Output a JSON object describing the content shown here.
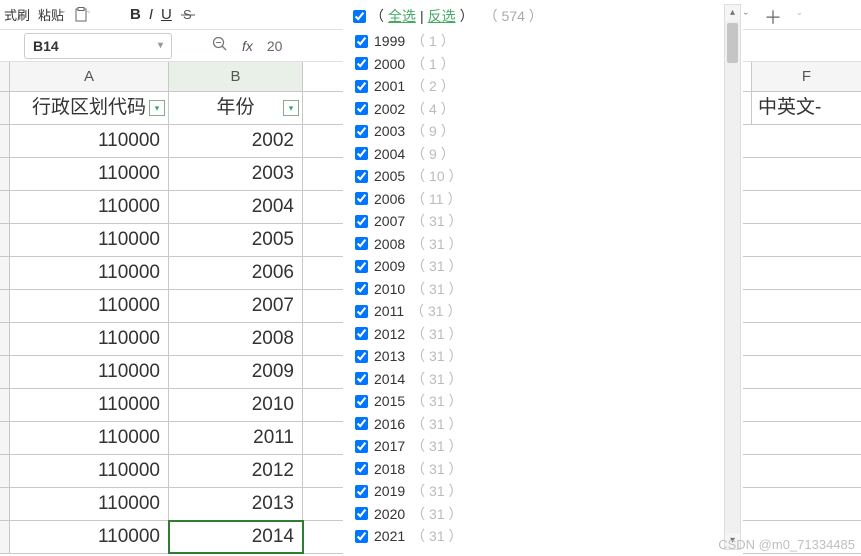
{
  "toolbar": {
    "format_painter": "式刷",
    "paste_lbl": "粘贴",
    "bold": "B",
    "italic": "I",
    "underline": "U",
    "plus": "＋",
    "chevron": "ˇ"
  },
  "namebox": {
    "ref": "B14"
  },
  "formula": {
    "fx": "fx",
    "value": "20"
  },
  "columns": {
    "a": "A",
    "b": "B",
    "right": "F"
  },
  "headers": {
    "a": "行政区划代码",
    "b": "年份",
    "right": "中英文-"
  },
  "rows": [
    {
      "a": "110000",
      "b": "2002"
    },
    {
      "a": "110000",
      "b": "2003"
    },
    {
      "a": "110000",
      "b": "2004"
    },
    {
      "a": "110000",
      "b": "2005"
    },
    {
      "a": "110000",
      "b": "2006"
    },
    {
      "a": "110000",
      "b": "2007"
    },
    {
      "a": "110000",
      "b": "2008"
    },
    {
      "a": "110000",
      "b": "2009"
    },
    {
      "a": "110000",
      "b": "2010"
    },
    {
      "a": "110000",
      "b": "2011"
    },
    {
      "a": "110000",
      "b": "2012"
    },
    {
      "a": "110000",
      "b": "2013"
    },
    {
      "a": "110000",
      "b": "2014"
    }
  ],
  "filter": {
    "select_all": "全选",
    "invert": "反选",
    "total": "（ 574 ）",
    "items": [
      {
        "year": "1999",
        "count": "（ 1 ）"
      },
      {
        "year": "2000",
        "count": "（ 1 ）"
      },
      {
        "year": "2001",
        "count": "（ 2 ）"
      },
      {
        "year": "2002",
        "count": "（ 4 ）"
      },
      {
        "year": "2003",
        "count": "（ 9 ）"
      },
      {
        "year": "2004",
        "count": "（ 9 ）"
      },
      {
        "year": "2005",
        "count": "（ 10 ）"
      },
      {
        "year": "2006",
        "count": "（ 11 ）"
      },
      {
        "year": "2007",
        "count": "（ 31 ）"
      },
      {
        "year": "2008",
        "count": "（ 31 ）"
      },
      {
        "year": "2009",
        "count": "（ 31 ）"
      },
      {
        "year": "2010",
        "count": "（ 31 ）"
      },
      {
        "year": "2011",
        "count": "（ 31 ）"
      },
      {
        "year": "2012",
        "count": "（ 31 ）"
      },
      {
        "year": "2013",
        "count": "（ 31 ）"
      },
      {
        "year": "2014",
        "count": "（ 31 ）"
      },
      {
        "year": "2015",
        "count": "（ 31 ）"
      },
      {
        "year": "2016",
        "count": "（ 31 ）"
      },
      {
        "year": "2017",
        "count": "（ 31 ）"
      },
      {
        "year": "2018",
        "count": "（ 31 ）"
      },
      {
        "year": "2019",
        "count": "（ 31 ）"
      },
      {
        "year": "2020",
        "count": "（ 31 ）"
      },
      {
        "year": "2021",
        "count": "（ 31 ）"
      }
    ]
  },
  "watermark": "CSDN @m0_71334485"
}
